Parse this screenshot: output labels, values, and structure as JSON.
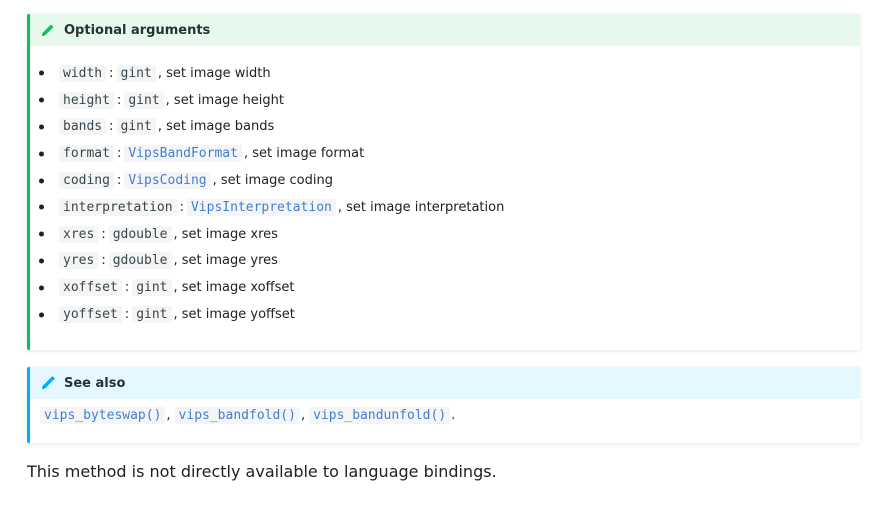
{
  "optional": {
    "title": "Optional arguments",
    "icon": "pencil-icon",
    "accent": "#00c853",
    "items": [
      {
        "name": "width",
        "type": "gint",
        "desc": ", set image width"
      },
      {
        "name": "height",
        "type": "gint",
        "desc": ", set image height"
      },
      {
        "name": "bands",
        "type": "gint",
        "desc": ", set image bands"
      },
      {
        "name": "format",
        "type": "VipsBandFormat",
        "desc": ", set image format"
      },
      {
        "name": "coding",
        "type": "VipsCoding",
        "desc": ", set image coding"
      },
      {
        "name": "interpretation",
        "type": "VipsInterpretation",
        "desc": ", set image interpretation"
      },
      {
        "name": "xres",
        "type": "gdouble",
        "desc": ", set image xres"
      },
      {
        "name": "yres",
        "type": "gdouble",
        "desc": ", set image yres"
      },
      {
        "name": "xoffset",
        "type": "gint",
        "desc": ", set image xoffset"
      },
      {
        "name": "yoffset",
        "type": "gint",
        "desc": ", set image yoffset"
      }
    ]
  },
  "see_also": {
    "title": "See also",
    "icon": "pencil-icon",
    "accent": "#00b0ff",
    "links": [
      "vips_byteswap()",
      "vips_bandfold()",
      "vips_bandunfold()"
    ]
  },
  "note": "This method is not directly available to language bindings."
}
